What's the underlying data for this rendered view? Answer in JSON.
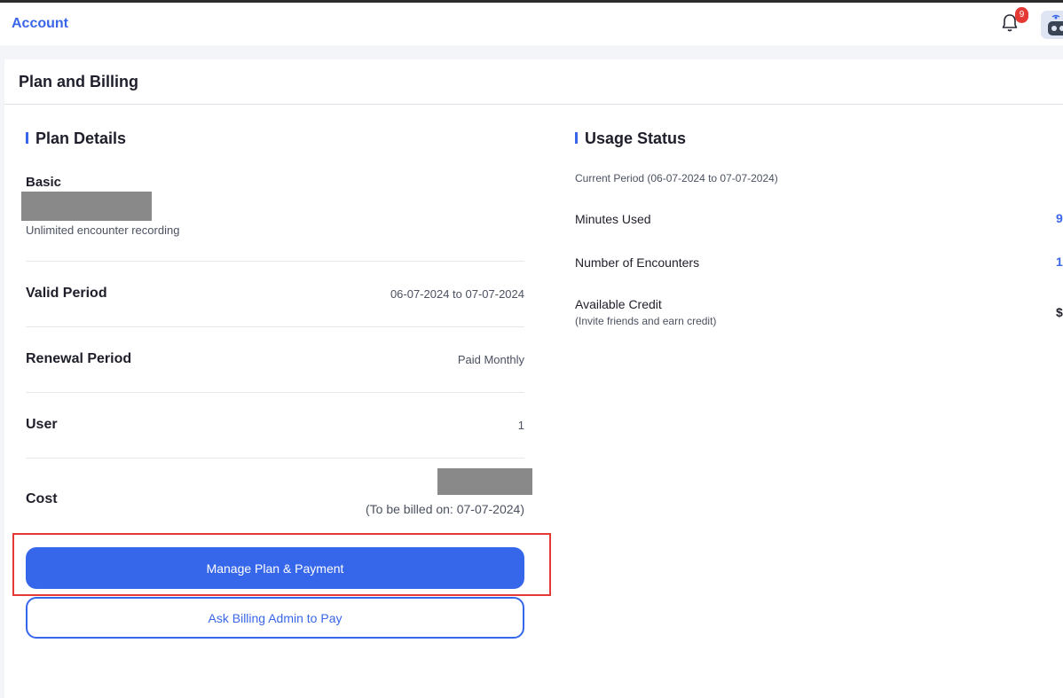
{
  "header": {
    "title": "Account",
    "notification_count": "9"
  },
  "card": {
    "title": "Plan and Billing"
  },
  "plan": {
    "heading": "Plan Details",
    "name": "Basic",
    "description": "Unlimited encounter recording",
    "rows": [
      {
        "label": "Valid Period",
        "value": "06-07-2024 to 07-07-2024"
      },
      {
        "label": "Renewal Period",
        "value": "Paid Monthly"
      },
      {
        "label": "User",
        "value": "1"
      },
      {
        "label": "Cost",
        "value": "(To be billed on: 07-07-2024)"
      }
    ],
    "manage_button": "Manage Plan & Payment",
    "ask_admin_button": "Ask Billing Admin to Pay"
  },
  "usage": {
    "heading": "Usage Status",
    "period": "Current Period (06-07-2024 to 07-07-2024)",
    "minutes_label": "Minutes Used",
    "minutes_value": "9",
    "encounters_label": "Number of Encounters",
    "encounters_value": "1",
    "credit_label": "Available Credit",
    "credit_sub": "(Invite friends and earn credit)",
    "credit_value": "$"
  },
  "colors": {
    "accent": "#3666ea",
    "badge": "#e53935",
    "highlight": "#e53935"
  },
  "icons": {
    "notifications": "bell-icon",
    "user": "robot-avatar-icon"
  }
}
